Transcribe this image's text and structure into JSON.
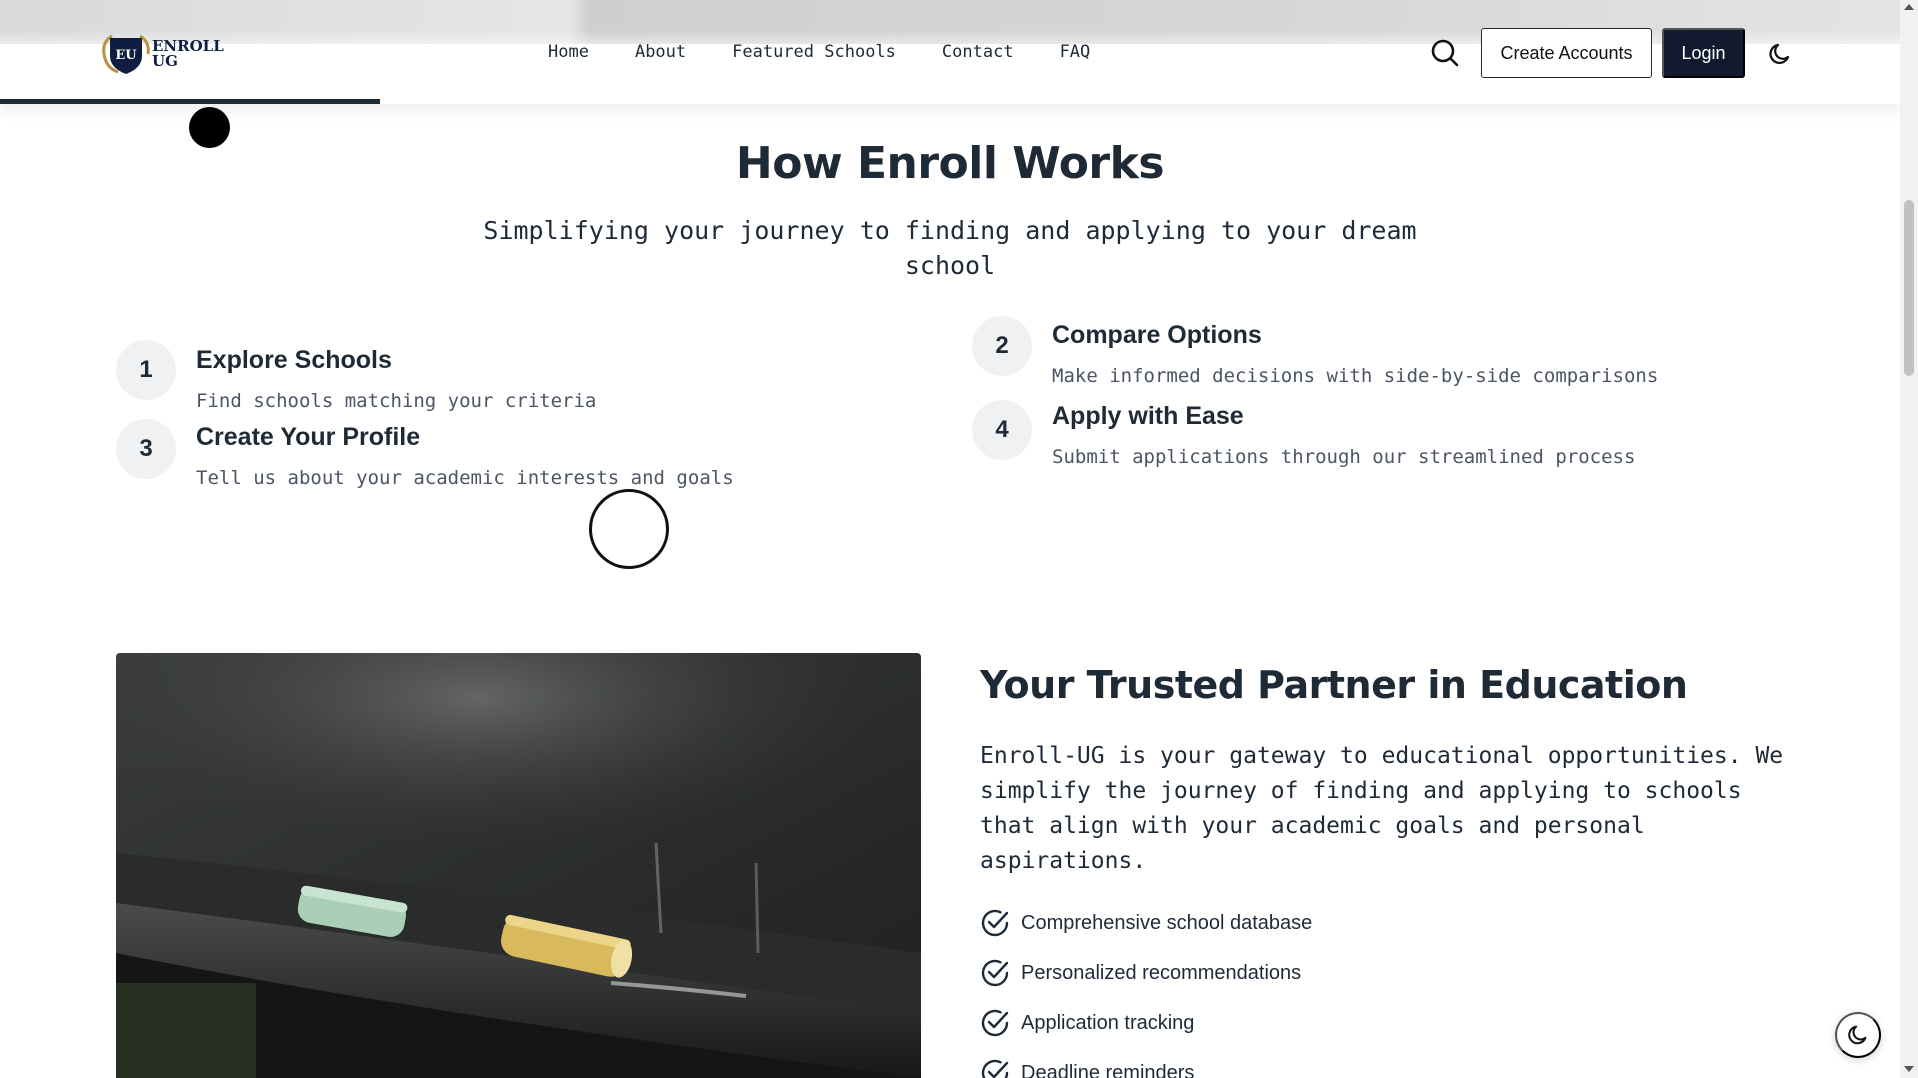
{
  "brand": {
    "logo_text_line1": "ENROLL",
    "logo_text_line2": "UG",
    "logo_monogram": "EU"
  },
  "nav": {
    "items": [
      "Home",
      "About",
      "Featured Schools",
      "Contact",
      "FAQ"
    ]
  },
  "header": {
    "search_icon": "search-icon",
    "create_accounts_label": "Create Accounts",
    "login_label": "Login",
    "theme_icon": "moon-icon",
    "scroll_progress_percent": 20
  },
  "how_it_works": {
    "title": "How Enroll Works",
    "subtitle": "Simplifying your journey to finding and applying to your dream school",
    "steps": [
      {
        "number": "1",
        "title": "Explore Schools",
        "description": "Find schools matching your criteria"
      },
      {
        "number": "2",
        "title": "Compare Options",
        "description": "Make informed decisions with side-by-side comparisons"
      },
      {
        "number": "3",
        "title": "Create Your Profile",
        "description": "Tell us about your academic interests and goals"
      },
      {
        "number": "4",
        "title": "Apply with Ease",
        "description": "Submit applications through our streamlined process"
      }
    ]
  },
  "partner": {
    "title": "Your Trusted Partner in Education",
    "description": "Enroll-UG is your gateway to educational opportunities. We simplify the journey of finding and applying to schools that align with your academic goals and personal aspirations.",
    "features": [
      "Comprehensive school database",
      "Personalized recommendations",
      "Application tracking",
      "Deadline reminders"
    ],
    "feature_icon": "check-circle-icon",
    "image_subject": "chalk-on-blackboard-photo"
  },
  "colors": {
    "primary_dark": "#111a2e",
    "text": "#1f2a37",
    "muted_text": "#4b5563",
    "step_circle": "#f0f1f3"
  }
}
